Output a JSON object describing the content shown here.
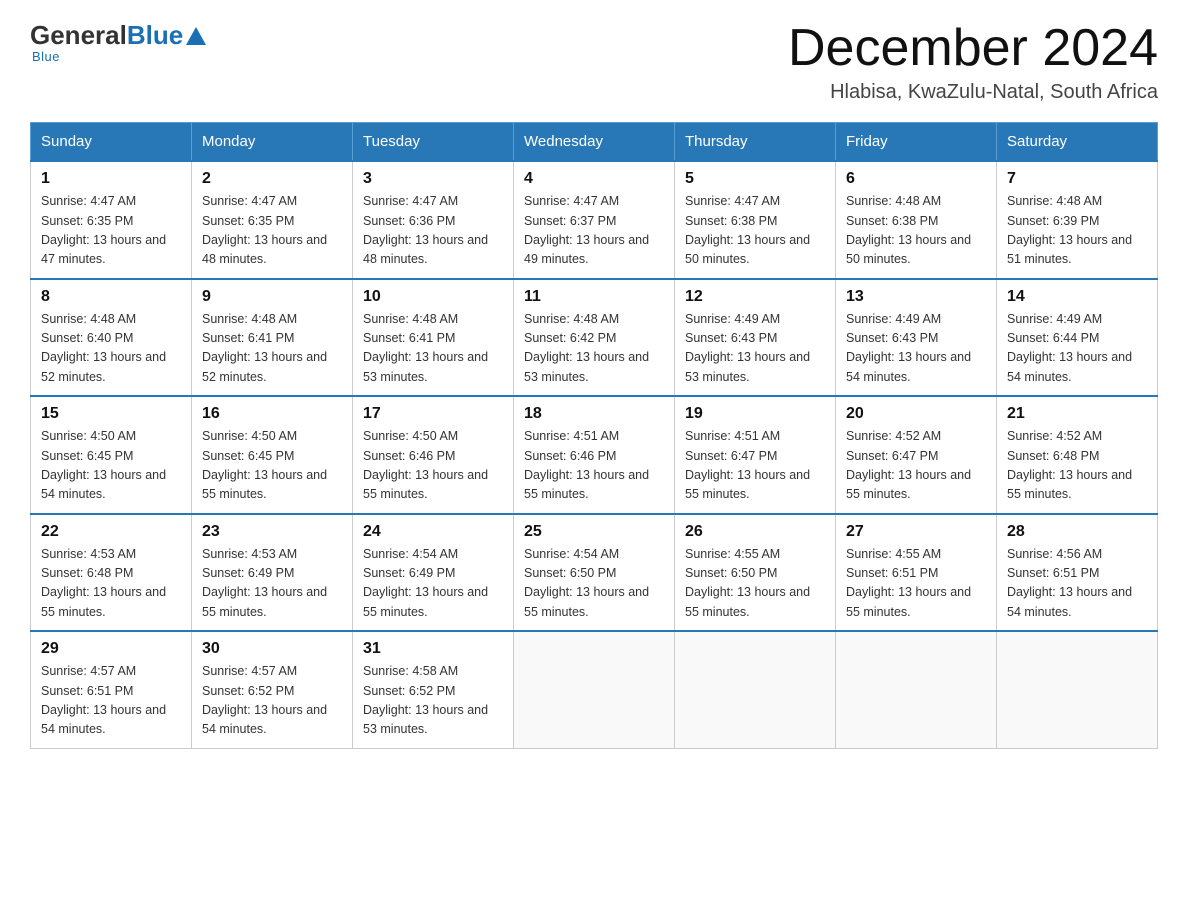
{
  "header": {
    "logo_general": "General",
    "logo_blue": "Blue",
    "month_title": "December 2024",
    "location": "Hlabisa, KwaZulu-Natal, South Africa"
  },
  "days_of_week": [
    "Sunday",
    "Monday",
    "Tuesday",
    "Wednesday",
    "Thursday",
    "Friday",
    "Saturday"
  ],
  "weeks": [
    [
      {
        "day": 1,
        "sunrise": "4:47 AM",
        "sunset": "6:35 PM",
        "daylight": "13 hours and 47 minutes."
      },
      {
        "day": 2,
        "sunrise": "4:47 AM",
        "sunset": "6:35 PM",
        "daylight": "13 hours and 48 minutes."
      },
      {
        "day": 3,
        "sunrise": "4:47 AM",
        "sunset": "6:36 PM",
        "daylight": "13 hours and 48 minutes."
      },
      {
        "day": 4,
        "sunrise": "4:47 AM",
        "sunset": "6:37 PM",
        "daylight": "13 hours and 49 minutes."
      },
      {
        "day": 5,
        "sunrise": "4:47 AM",
        "sunset": "6:38 PM",
        "daylight": "13 hours and 50 minutes."
      },
      {
        "day": 6,
        "sunrise": "4:48 AM",
        "sunset": "6:38 PM",
        "daylight": "13 hours and 50 minutes."
      },
      {
        "day": 7,
        "sunrise": "4:48 AM",
        "sunset": "6:39 PM",
        "daylight": "13 hours and 51 minutes."
      }
    ],
    [
      {
        "day": 8,
        "sunrise": "4:48 AM",
        "sunset": "6:40 PM",
        "daylight": "13 hours and 52 minutes."
      },
      {
        "day": 9,
        "sunrise": "4:48 AM",
        "sunset": "6:41 PM",
        "daylight": "13 hours and 52 minutes."
      },
      {
        "day": 10,
        "sunrise": "4:48 AM",
        "sunset": "6:41 PM",
        "daylight": "13 hours and 53 minutes."
      },
      {
        "day": 11,
        "sunrise": "4:48 AM",
        "sunset": "6:42 PM",
        "daylight": "13 hours and 53 minutes."
      },
      {
        "day": 12,
        "sunrise": "4:49 AM",
        "sunset": "6:43 PM",
        "daylight": "13 hours and 53 minutes."
      },
      {
        "day": 13,
        "sunrise": "4:49 AM",
        "sunset": "6:43 PM",
        "daylight": "13 hours and 54 minutes."
      },
      {
        "day": 14,
        "sunrise": "4:49 AM",
        "sunset": "6:44 PM",
        "daylight": "13 hours and 54 minutes."
      }
    ],
    [
      {
        "day": 15,
        "sunrise": "4:50 AM",
        "sunset": "6:45 PM",
        "daylight": "13 hours and 54 minutes."
      },
      {
        "day": 16,
        "sunrise": "4:50 AM",
        "sunset": "6:45 PM",
        "daylight": "13 hours and 55 minutes."
      },
      {
        "day": 17,
        "sunrise": "4:50 AM",
        "sunset": "6:46 PM",
        "daylight": "13 hours and 55 minutes."
      },
      {
        "day": 18,
        "sunrise": "4:51 AM",
        "sunset": "6:46 PM",
        "daylight": "13 hours and 55 minutes."
      },
      {
        "day": 19,
        "sunrise": "4:51 AM",
        "sunset": "6:47 PM",
        "daylight": "13 hours and 55 minutes."
      },
      {
        "day": 20,
        "sunrise": "4:52 AM",
        "sunset": "6:47 PM",
        "daylight": "13 hours and 55 minutes."
      },
      {
        "day": 21,
        "sunrise": "4:52 AM",
        "sunset": "6:48 PM",
        "daylight": "13 hours and 55 minutes."
      }
    ],
    [
      {
        "day": 22,
        "sunrise": "4:53 AM",
        "sunset": "6:48 PM",
        "daylight": "13 hours and 55 minutes."
      },
      {
        "day": 23,
        "sunrise": "4:53 AM",
        "sunset": "6:49 PM",
        "daylight": "13 hours and 55 minutes."
      },
      {
        "day": 24,
        "sunrise": "4:54 AM",
        "sunset": "6:49 PM",
        "daylight": "13 hours and 55 minutes."
      },
      {
        "day": 25,
        "sunrise": "4:54 AM",
        "sunset": "6:50 PM",
        "daylight": "13 hours and 55 minutes."
      },
      {
        "day": 26,
        "sunrise": "4:55 AM",
        "sunset": "6:50 PM",
        "daylight": "13 hours and 55 minutes."
      },
      {
        "day": 27,
        "sunrise": "4:55 AM",
        "sunset": "6:51 PM",
        "daylight": "13 hours and 55 minutes."
      },
      {
        "day": 28,
        "sunrise": "4:56 AM",
        "sunset": "6:51 PM",
        "daylight": "13 hours and 54 minutes."
      }
    ],
    [
      {
        "day": 29,
        "sunrise": "4:57 AM",
        "sunset": "6:51 PM",
        "daylight": "13 hours and 54 minutes."
      },
      {
        "day": 30,
        "sunrise": "4:57 AM",
        "sunset": "6:52 PM",
        "daylight": "13 hours and 54 minutes."
      },
      {
        "day": 31,
        "sunrise": "4:58 AM",
        "sunset": "6:52 PM",
        "daylight": "13 hours and 53 minutes."
      },
      null,
      null,
      null,
      null
    ]
  ],
  "colors": {
    "header_bg": "#2878b8",
    "border": "#ccc"
  }
}
